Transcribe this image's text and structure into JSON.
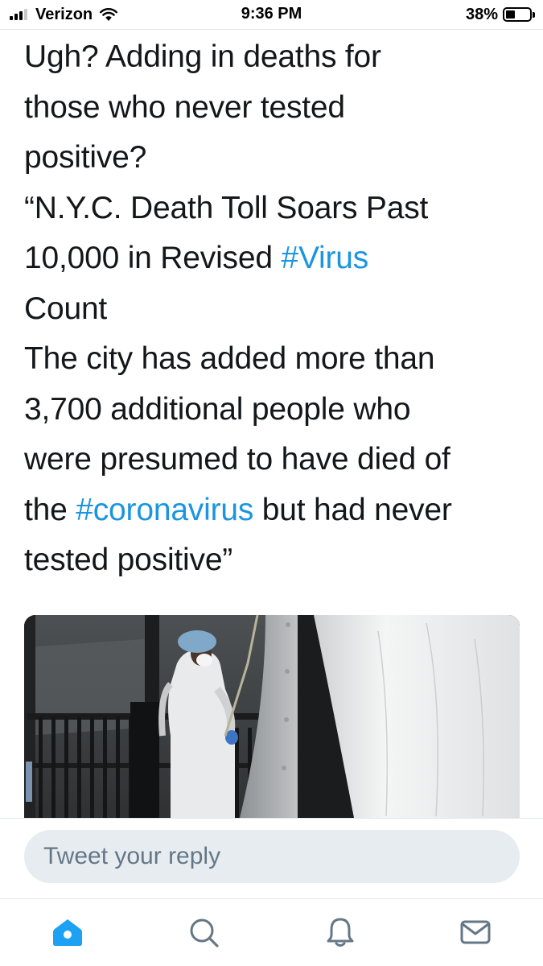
{
  "status_bar": {
    "carrier": "Verizon",
    "time": "9:36 PM",
    "battery_percent": "38%",
    "battery_level": 0.38,
    "signal_bars": 3,
    "icons": [
      "signal-icon",
      "wifi-icon",
      "battery-icon"
    ]
  },
  "tweet": {
    "lines": [
      [
        {
          "t": "Ugh? Adding in deaths for"
        }
      ],
      [
        {
          "t": "those who never tested"
        }
      ],
      [
        {
          "t": "positive?"
        }
      ],
      [
        {
          "t": "“N.Y.C. Death Toll Soars Past"
        }
      ],
      [
        {
          "t": "10,000 in Revised "
        },
        {
          "t": "#Virus",
          "tag": true
        }
      ],
      [
        {
          "t": "Count"
        }
      ],
      [
        {
          "t": "The city has added more than"
        }
      ],
      [
        {
          "t": "3,700 additional people who"
        }
      ],
      [
        {
          "t": "were presumed to have died of"
        }
      ],
      [
        {
          "t": "the "
        },
        {
          "t": "#coronavirus",
          "tag": true
        },
        {
          "t": " but had never"
        }
      ],
      [
        {
          "t": "tested positive”"
        }
      ]
    ],
    "hashtag_color": "#1b95e0"
  },
  "reply": {
    "placeholder": "Tweet your reply"
  },
  "tab_bar": {
    "active_color": "#1da1f2",
    "inactive_color": "#657786",
    "tabs": [
      {
        "name": "home",
        "icon": "home-icon",
        "active": true
      },
      {
        "name": "search",
        "icon": "search-icon",
        "active": false
      },
      {
        "name": "notifications",
        "icon": "bell-icon",
        "active": false
      },
      {
        "name": "messages",
        "icon": "mail-icon",
        "active": false
      }
    ]
  }
}
